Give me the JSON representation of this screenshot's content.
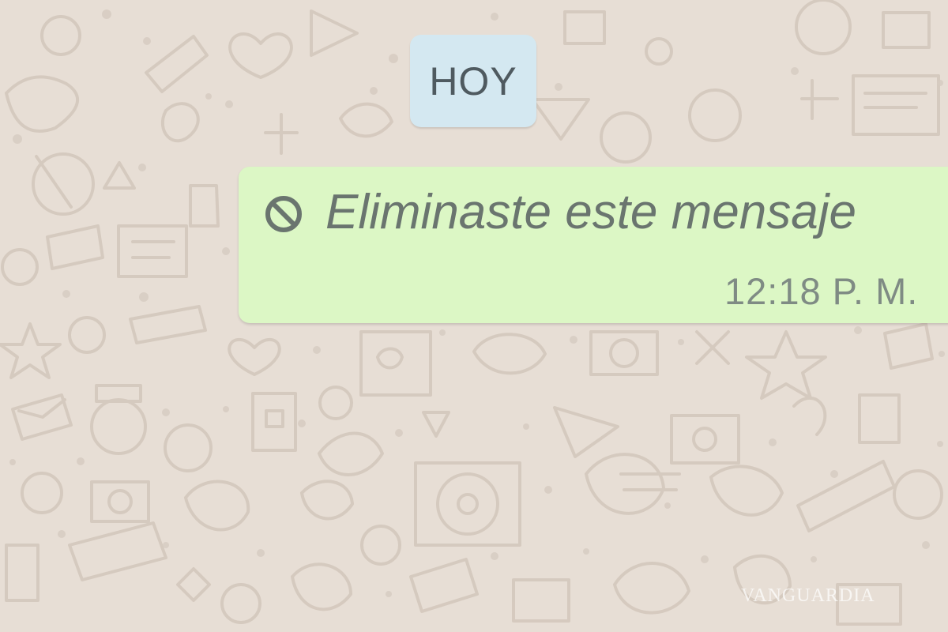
{
  "chat": {
    "date_separator": "HOY",
    "messages": [
      {
        "status": "deleted",
        "text": "Eliminaste este mensaje",
        "time": "12:18 P. M."
      }
    ]
  },
  "watermark": "VANGUARDIA",
  "icons": {
    "deleted_message": "ban-icon"
  },
  "colors": {
    "wallpaper": "#e7ded5",
    "date_chip": "#d4e8f1",
    "outgoing_bubble": "#dcf7c5",
    "deleted_text": "#6a756f"
  }
}
